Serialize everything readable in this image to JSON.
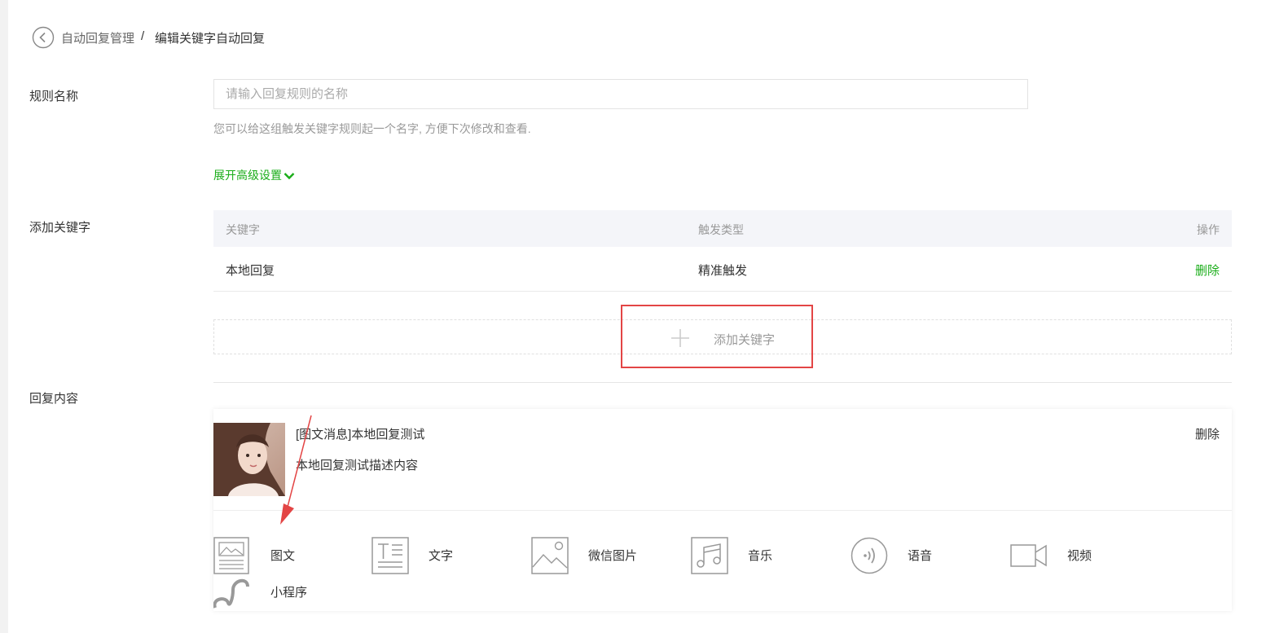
{
  "breadcrumb": {
    "parent": "自动回复管理",
    "separator": "/",
    "current": "编辑关键字自动回复"
  },
  "rule_name": {
    "label": "规则名称",
    "placeholder": "请输入回复规则的名称",
    "value": "",
    "hint": "您可以给这组触发关键字规则起一个名字, 方便下次修改和查看.",
    "advanced_link": "展开高级设置"
  },
  "keywords": {
    "label": "添加关键字",
    "columns": [
      "关键字",
      "触发类型",
      "操作"
    ],
    "rows": [
      {
        "keyword": "本地回复",
        "trigger": "精准触发",
        "action": "删除"
      }
    ],
    "add_button": "添加关键字"
  },
  "reply": {
    "label": "回复内容",
    "item": {
      "title": "[图文消息]本地回复测试",
      "description": "本地回复测试描述内容",
      "delete": "删除"
    },
    "types": [
      {
        "label": "图文",
        "icon": "news-icon"
      },
      {
        "label": "文字",
        "icon": "text-icon"
      },
      {
        "label": "微信图片",
        "icon": "image-icon"
      },
      {
        "label": "音乐",
        "icon": "music-icon"
      },
      {
        "label": "语音",
        "icon": "voice-icon"
      },
      {
        "label": "视频",
        "icon": "video-icon"
      },
      {
        "label": "小程序",
        "icon": "miniprogram-icon"
      }
    ]
  },
  "colors": {
    "accent": "#1aad19",
    "highlight": "#e34545"
  }
}
